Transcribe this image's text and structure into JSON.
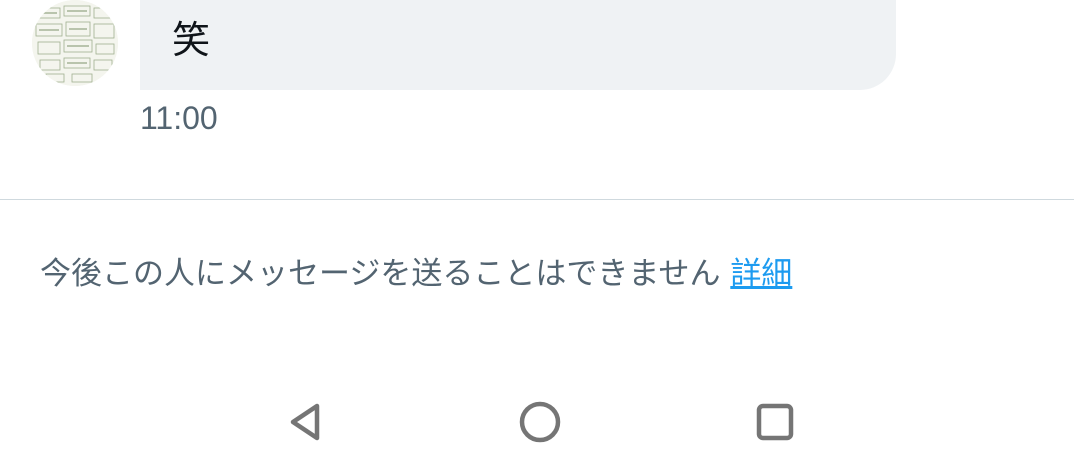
{
  "message": {
    "text": "笑",
    "time": "11:00"
  },
  "notice": {
    "text": "今後この人にメッセージを送ることはできません",
    "link_label": "詳細"
  },
  "navbar": {
    "back_icon": "triangle-back-icon",
    "home_icon": "circle-home-icon",
    "recent_icon": "square-recents-icon"
  },
  "colors": {
    "bubble_bg": "#eff2f4",
    "link": "#1d9bf0",
    "secondary_text": "#536471",
    "nav_icon": "#757575"
  }
}
